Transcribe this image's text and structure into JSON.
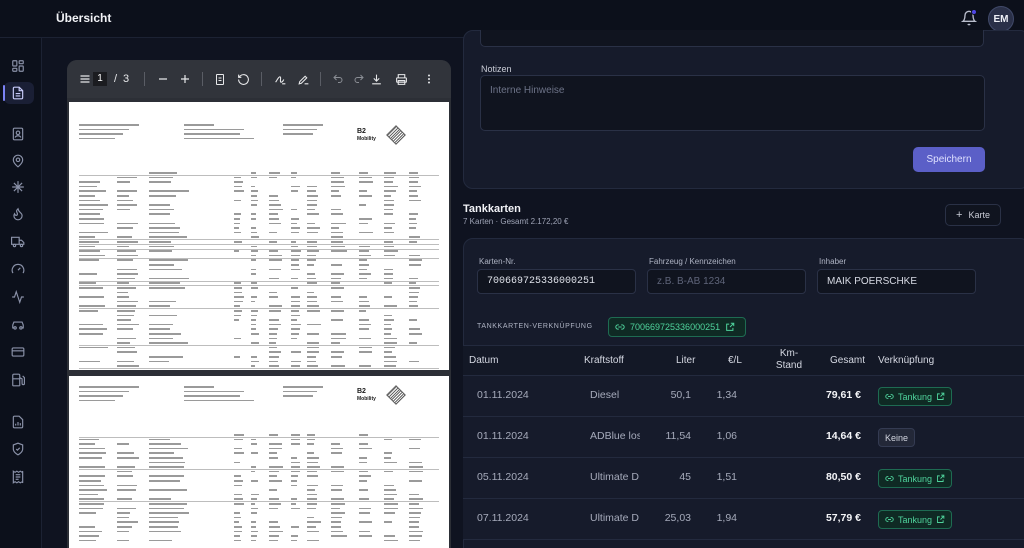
{
  "header": {
    "title": "Übersicht",
    "avatar_initials": "EM"
  },
  "sidebar": {
    "items": [
      {
        "icon": "dashboard-grid-icon"
      },
      {
        "icon": "document-icon",
        "active": true
      },
      {
        "icon": "contact-card-icon"
      },
      {
        "icon": "location-pin-icon"
      },
      {
        "icon": "snowflake-icon"
      },
      {
        "icon": "flame-icon"
      },
      {
        "icon": "truck-icon"
      },
      {
        "icon": "gauge-icon"
      },
      {
        "icon": "activity-icon"
      },
      {
        "icon": "car-icon"
      },
      {
        "icon": "credit-card-icon"
      },
      {
        "icon": "fuel-pump-icon"
      },
      {
        "icon": "report-icon"
      },
      {
        "icon": "shield-check-icon"
      },
      {
        "icon": "receipt-icon"
      }
    ]
  },
  "pdf_viewer": {
    "current_page": "1",
    "page_separator": "/",
    "total_pages": "3"
  },
  "notes": {
    "label": "Notizen",
    "placeholder": "Interne Hinweise",
    "save_label": "Speichern"
  },
  "tankkarten": {
    "title": "Tankkarten",
    "subtitle": "7 Karten · Gesamt 2.172,20 €",
    "add_label": "Karte",
    "fields": {
      "card_no_label": "Karten-Nr.",
      "card_no_value": "700669725336000251",
      "vehicle_label": "Fahrzeug / Kennzeichen",
      "vehicle_placeholder": "z.B. B-AB 1234",
      "owner_label": "Inhaber",
      "owner_value": "MAIK POERSCHKE"
    },
    "link_label": "TANKKARTEN-VERKNÜPFUNG",
    "link_value": "700669725336000251"
  },
  "table": {
    "headers": {
      "datum": "Datum",
      "kraftstoff": "Kraftstoff",
      "liter": "Liter",
      "eur_l": "€/L",
      "km_stand": "Km-\nStand",
      "gesamt": "Gesamt",
      "verknuepfung": "Verknüpfung"
    },
    "rows": [
      {
        "datum": "01.11.2024",
        "kraftstoff": "Diesel",
        "liter": "50,1",
        "eur_l": "1,34",
        "gesamt": "79,61 €",
        "link": "Tankung",
        "linked": true
      },
      {
        "datum": "01.11.2024",
        "kraftstoff": "ADBlue los",
        "liter": "11,54",
        "eur_l": "1,06",
        "gesamt": "14,64 €",
        "link": "Keine",
        "linked": false
      },
      {
        "datum": "05.11.2024",
        "kraftstoff": "Ultimate D",
        "liter": "45",
        "eur_l": "1,51",
        "gesamt": "80,50 €",
        "link": "Tankung",
        "linked": true
      },
      {
        "datum": "07.11.2024",
        "kraftstoff": "Ultimate D",
        "liter": "25,03",
        "eur_l": "1,94",
        "gesamt": "57,79 €",
        "link": "Tankung",
        "linked": true
      }
    ]
  },
  "colors": {
    "accent": "#5b5fc7",
    "link_green": "#4fd39c",
    "background": "#0f1320",
    "card": "#161b2b"
  }
}
